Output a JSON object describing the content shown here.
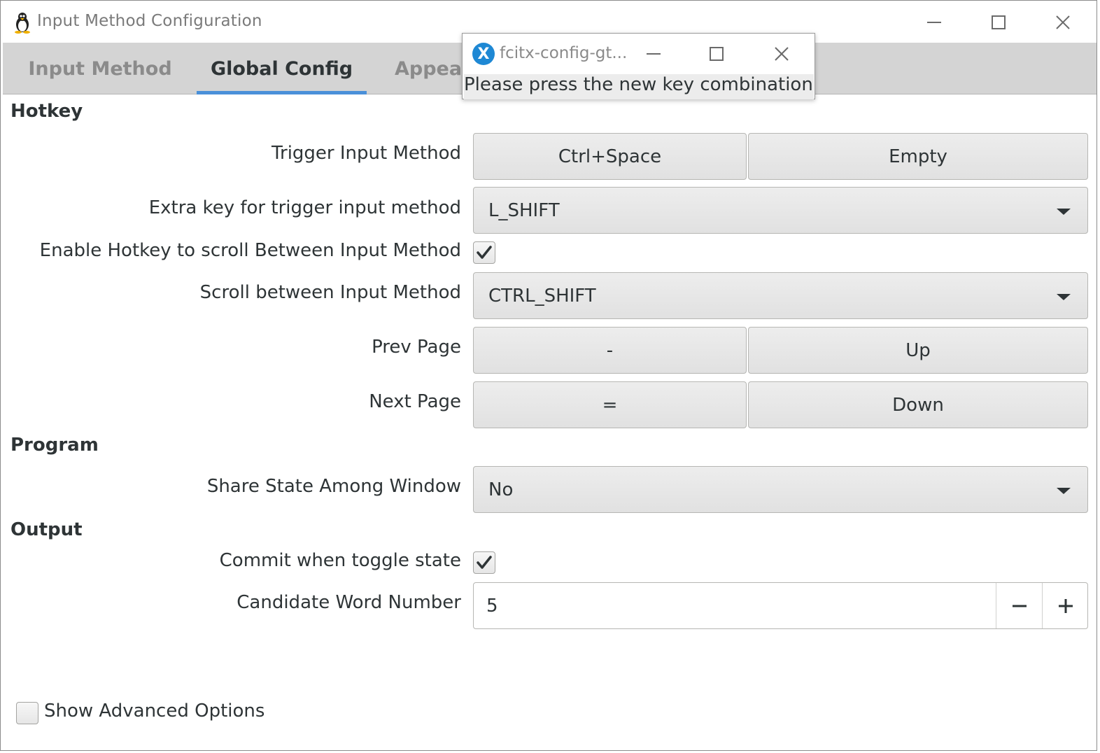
{
  "window": {
    "title": "Input Method Configuration",
    "icons": {
      "app": "tux-penguin-icon",
      "minimize": "minimize-icon",
      "maximize": "maximize-icon",
      "close": "close-icon"
    }
  },
  "tabs": [
    {
      "label": "Input Method",
      "active": false
    },
    {
      "label": "Global Config",
      "active": true
    },
    {
      "label": "Appear",
      "active": false
    }
  ],
  "accent_color": "#4a90d9",
  "hotkey": {
    "header": "Hotkey",
    "trigger": {
      "label": "Trigger Input Method",
      "key1": "Ctrl+Space",
      "key2": "Empty"
    },
    "extra_key": {
      "label": "Extra key for trigger input method",
      "value": "L_SHIFT"
    },
    "enable_scroll": {
      "label": "Enable Hotkey to scroll Between Input Method",
      "checked": true
    },
    "scroll": {
      "label": "Scroll between Input Method",
      "value": "CTRL_SHIFT"
    },
    "prev_page": {
      "label": "Prev Page",
      "key1": "-",
      "key2": "Up"
    },
    "next_page": {
      "label": "Next Page",
      "key1": "=",
      "key2": "Down"
    }
  },
  "program": {
    "header": "Program",
    "share_state": {
      "label": "Share State Among Window",
      "value": "No"
    }
  },
  "output": {
    "header": "Output",
    "commit_toggle": {
      "label": "Commit when toggle state",
      "checked": true
    },
    "candidate_number": {
      "label": "Candidate Word Number",
      "value": "5"
    }
  },
  "advanced": {
    "label": "Show Advanced Options",
    "checked": false
  },
  "popup": {
    "title": "fcitx-config-gt...",
    "icon_letter": "X",
    "message": "Please press the new key combination"
  }
}
